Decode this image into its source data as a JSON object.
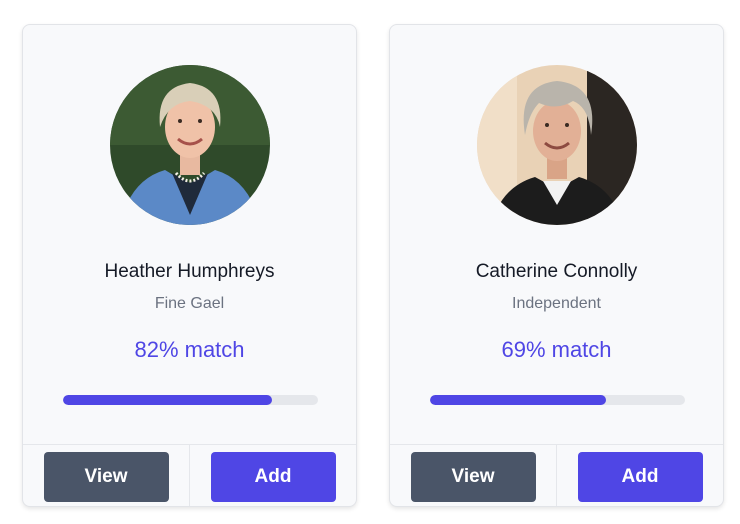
{
  "candidates": [
    {
      "name": "Heather Humphreys",
      "party": "Fine Gael",
      "match_text": "82% match",
      "match_fraction": 0.82,
      "photo": "portrait-photo",
      "view_label": "View",
      "add_label": "Add"
    },
    {
      "name": "Catherine Connolly",
      "party": "Independent",
      "match_text": "69% match",
      "match_fraction": 0.69,
      "photo": "portrait-photo",
      "view_label": "View",
      "add_label": "Add"
    }
  ],
  "colors": {
    "accent": "#4f46e5",
    "view_button": "#4a5568",
    "progress_track": "#e5e7eb",
    "card_background": "#f8f9fb"
  }
}
